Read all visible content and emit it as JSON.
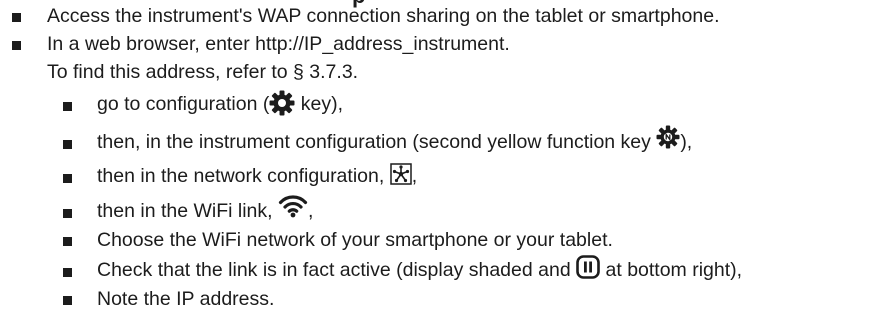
{
  "header": {
    "partial_heading": "p"
  },
  "steps": [
    {
      "text": "Access the instrument's WAP connection sharing on the tablet or smartphone."
    },
    {
      "text": "In a web browser, enter http://IP_address_instrument."
    }
  ],
  "note": "To find this address, refer to § 3.7.3.",
  "substeps": {
    "config": {
      "before": "go to configuration (",
      "after": " key),"
    },
    "instrument": {
      "before": "then, in the instrument configuration (second yellow function key ",
      "after": "),"
    },
    "network": {
      "before": "then in the network configuration, ",
      "after": ","
    },
    "wifi": {
      "before": "then in the WiFi link, ",
      "after": ","
    },
    "choose": {
      "text": "Choose the WiFi network of your smartphone or your tablet."
    },
    "check": {
      "before": "Check that the link is in fact active (display shaded and ",
      "after": " at bottom right),"
    },
    "note_ip": {
      "text": "Note the IP address."
    }
  },
  "icons": {
    "gear": "gear-icon",
    "gear_n": "gear-n-icon",
    "network": "network-icon",
    "wifi": "wifi-icon",
    "pause": "pause-icon"
  }
}
